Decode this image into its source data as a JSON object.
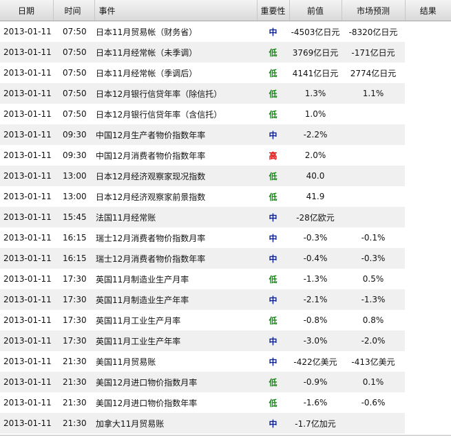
{
  "header": {
    "date": "日期",
    "time": "时间",
    "event": "事件",
    "importance": "重要性",
    "previous": "前值",
    "forecast": "市场预测",
    "result": "结果"
  },
  "importance_colors": {
    "高": "#e00000",
    "中": "#0a1f8f",
    "低": "#138a13"
  },
  "rows": [
    {
      "date": "2013-01-11",
      "time": "07:50",
      "event": "日本11月贸易帐（财务省）",
      "importance": "中",
      "previous": "-4503亿日元",
      "forecast": "-8320亿日元",
      "result": ""
    },
    {
      "date": "2013-01-11",
      "time": "07:50",
      "event": "日本11月经常帐（未季调）",
      "importance": "低",
      "previous": "3769亿日元",
      "forecast": "-171亿日元",
      "result": ""
    },
    {
      "date": "2013-01-11",
      "time": "07:50",
      "event": "日本11月经常帐（季调后）",
      "importance": "低",
      "previous": "4141亿日元",
      "forecast": "2774亿日元",
      "result": ""
    },
    {
      "date": "2013-01-11",
      "time": "07:50",
      "event": "日本12月银行信贷年率（除信托）",
      "importance": "低",
      "previous": "1.3%",
      "forecast": "1.1%",
      "result": ""
    },
    {
      "date": "2013-01-11",
      "time": "07:50",
      "event": "日本12月银行信贷年率（含信托）",
      "importance": "低",
      "previous": "1.0%",
      "forecast": "",
      "result": ""
    },
    {
      "date": "2013-01-11",
      "time": "09:30",
      "event": "中国12月生产者物价指数年率",
      "importance": "中",
      "previous": "-2.2%",
      "forecast": "",
      "result": ""
    },
    {
      "date": "2013-01-11",
      "time": "09:30",
      "event": "中国12月消费者物价指数年率",
      "importance": "高",
      "previous": "2.0%",
      "forecast": "",
      "result": ""
    },
    {
      "date": "2013-01-11",
      "time": "13:00",
      "event": "日本12月经济观察家现况指数",
      "importance": "低",
      "previous": "40.0",
      "forecast": "",
      "result": ""
    },
    {
      "date": "2013-01-11",
      "time": "13:00",
      "event": "日本12月经济观察家前景指数",
      "importance": "低",
      "previous": "41.9",
      "forecast": "",
      "result": ""
    },
    {
      "date": "2013-01-11",
      "time": "15:45",
      "event": "法国11月经常账",
      "importance": "中",
      "previous": "-28亿欧元",
      "forecast": "",
      "result": ""
    },
    {
      "date": "2013-01-11",
      "time": "16:15",
      "event": "瑞士12月消费者物价指数月率",
      "importance": "中",
      "previous": "-0.3%",
      "forecast": "-0.1%",
      "result": ""
    },
    {
      "date": "2013-01-11",
      "time": "16:15",
      "event": "瑞士12月消费者物价指数年率",
      "importance": "中",
      "previous": "-0.4%",
      "forecast": "-0.3%",
      "result": ""
    },
    {
      "date": "2013-01-11",
      "time": "17:30",
      "event": "英国11月制造业生产月率",
      "importance": "低",
      "previous": "-1.3%",
      "forecast": "0.5%",
      "result": ""
    },
    {
      "date": "2013-01-11",
      "time": "17:30",
      "event": "英国11月制造业生产年率",
      "importance": "中",
      "previous": "-2.1%",
      "forecast": "-1.3%",
      "result": ""
    },
    {
      "date": "2013-01-11",
      "time": "17:30",
      "event": "英国11月工业生产月率",
      "importance": "低",
      "previous": "-0.8%",
      "forecast": "0.8%",
      "result": ""
    },
    {
      "date": "2013-01-11",
      "time": "17:30",
      "event": "英国11月工业生产年率",
      "importance": "中",
      "previous": "-3.0%",
      "forecast": "-2.0%",
      "result": ""
    },
    {
      "date": "2013-01-11",
      "time": "21:30",
      "event": "美国11月贸易账",
      "importance": "中",
      "previous": "-422亿美元",
      "forecast": "-413亿美元",
      "result": ""
    },
    {
      "date": "2013-01-11",
      "time": "21:30",
      "event": "美国12月进口物价指数月率",
      "importance": "低",
      "previous": "-0.9%",
      "forecast": "0.1%",
      "result": ""
    },
    {
      "date": "2013-01-11",
      "time": "21:30",
      "event": "美国12月进口物价指数年率",
      "importance": "低",
      "previous": "-1.6%",
      "forecast": "-0.6%",
      "result": ""
    },
    {
      "date": "2013-01-11",
      "time": "21:30",
      "event": "加拿大11月贸易账",
      "importance": "中",
      "previous": "-1.7亿加元",
      "forecast": "",
      "result": ""
    }
  ]
}
